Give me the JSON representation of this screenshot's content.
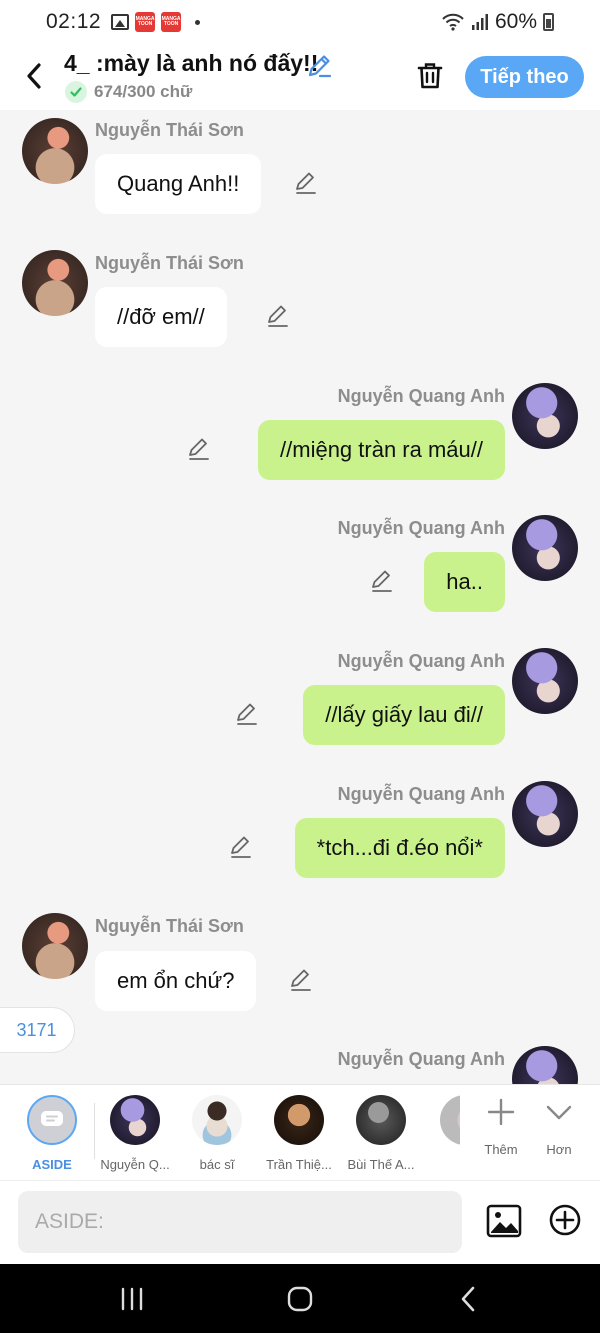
{
  "status_bar": {
    "time": "02:12",
    "battery": "60%",
    "badge_text": "MANGA TOON"
  },
  "header": {
    "title": "4_ :mày là anh nó đấy!!",
    "word_count": "674/300 chữ",
    "next_label": "Tiếp theo"
  },
  "messages": [
    {
      "sender": "Nguyễn Thái Sơn",
      "text": "Quang Anh!!",
      "side": "left"
    },
    {
      "sender": "Nguyễn Thái Sơn",
      "text": "//đỡ em//",
      "side": "left"
    },
    {
      "sender": "Nguyễn Quang Anh",
      "text": "//miệng tràn ra máu//",
      "side": "right"
    },
    {
      "sender": "Nguyễn Quang Anh",
      "text": "ha..",
      "side": "right"
    },
    {
      "sender": "Nguyễn Quang Anh",
      "text": "//lấy giấy lau đi//",
      "side": "right"
    },
    {
      "sender": "Nguyễn Quang Anh",
      "text": "*tch...đi đ.éo nổi*",
      "side": "right"
    },
    {
      "sender": "Nguyễn Thái Sơn",
      "text": "em ổn chứ?",
      "side": "left"
    },
    {
      "sender": "Nguyễn Quang Anh",
      "text": "",
      "side": "right"
    }
  ],
  "counter": "3171",
  "characters": [
    {
      "label": "ASIDE"
    },
    {
      "label": "Nguyễn Q..."
    },
    {
      "label": "bác sĩ"
    },
    {
      "label": "Trần Thiệ..."
    },
    {
      "label": "Bùi Thế A..."
    }
  ],
  "bar_actions": {
    "more_label": "Thêm",
    "expand_label": "Hơn"
  },
  "input": {
    "placeholder": "ASIDE:"
  },
  "colors": {
    "accent": "#5aa7f5",
    "right_bubble": "#c9f28c",
    "left_bubble": "#ffffff",
    "background": "#f5f5f5"
  }
}
